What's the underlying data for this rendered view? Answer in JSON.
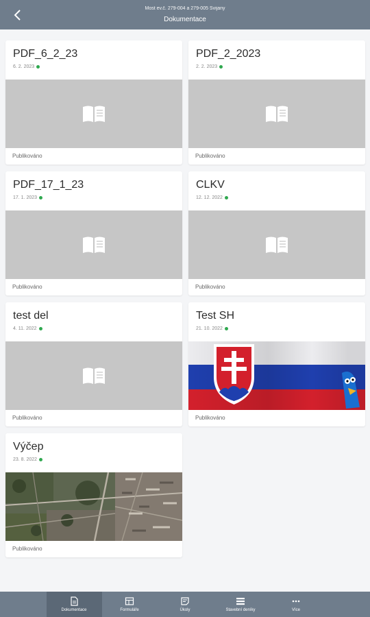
{
  "header": {
    "subtitle": "Most ev.č. 279-004 a 279-005 Svijany",
    "title": "Dokumentace",
    "back_icon": "arrow-left-icon"
  },
  "documents": [
    {
      "name": "PDF_6_2_23",
      "date": "6. 2. 2023",
      "status": "Publikováno",
      "thumbnail": "book-placeholder"
    },
    {
      "name": "PDF_2_2023",
      "date": "2. 2. 2023",
      "status": "Publikováno",
      "thumbnail": "book-placeholder"
    },
    {
      "name": "PDF_17_1_23",
      "date": "17. 1. 2023",
      "status": "Publikováno",
      "thumbnail": "book-placeholder"
    },
    {
      "name": "CLKV",
      "date": "12. 12. 2022",
      "status": "Publikováno",
      "thumbnail": "book-placeholder"
    },
    {
      "name": "test del",
      "date": "4. 11. 2022",
      "status": "Publikováno",
      "thumbnail": "book-placeholder"
    },
    {
      "name": "Test SH",
      "date": "21. 10. 2022",
      "status": "Publikováno",
      "thumbnail": "slovak-flag-photo"
    },
    {
      "name": "Výčep",
      "date": "23. 8. 2022",
      "status": "Publikováno",
      "thumbnail": "aerial-city-photo"
    }
  ],
  "status_dot_color": "#2fa84f",
  "bottom_nav": [
    {
      "label": "Dokumentace",
      "icon": "document-icon",
      "active": true
    },
    {
      "label": "Formuláře",
      "icon": "table-icon",
      "active": false
    },
    {
      "label": "Úkoly",
      "icon": "note-icon",
      "active": false
    },
    {
      "label": "Stavební deníky",
      "icon": "list-icon",
      "active": false
    },
    {
      "label": "Více",
      "icon": "more-icon",
      "active": false
    }
  ],
  "colors": {
    "bar": "#6f7d8c",
    "bar_active": "#5b6876",
    "placeholder": "#c6c6c6"
  }
}
